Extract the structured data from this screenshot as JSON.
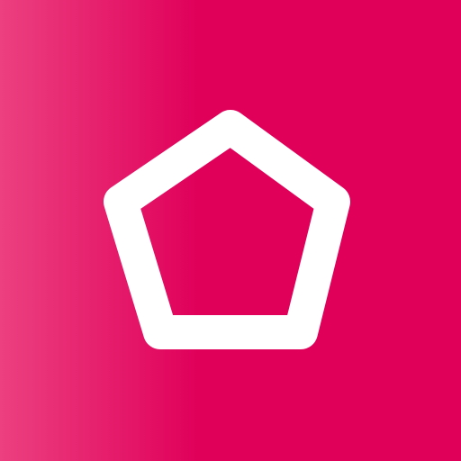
{
  "icon": {
    "name": "pentagon-icon",
    "background_color": "#e0005a",
    "background_gradient_start": "#ec4080",
    "glyph_color": "#ffffff"
  }
}
